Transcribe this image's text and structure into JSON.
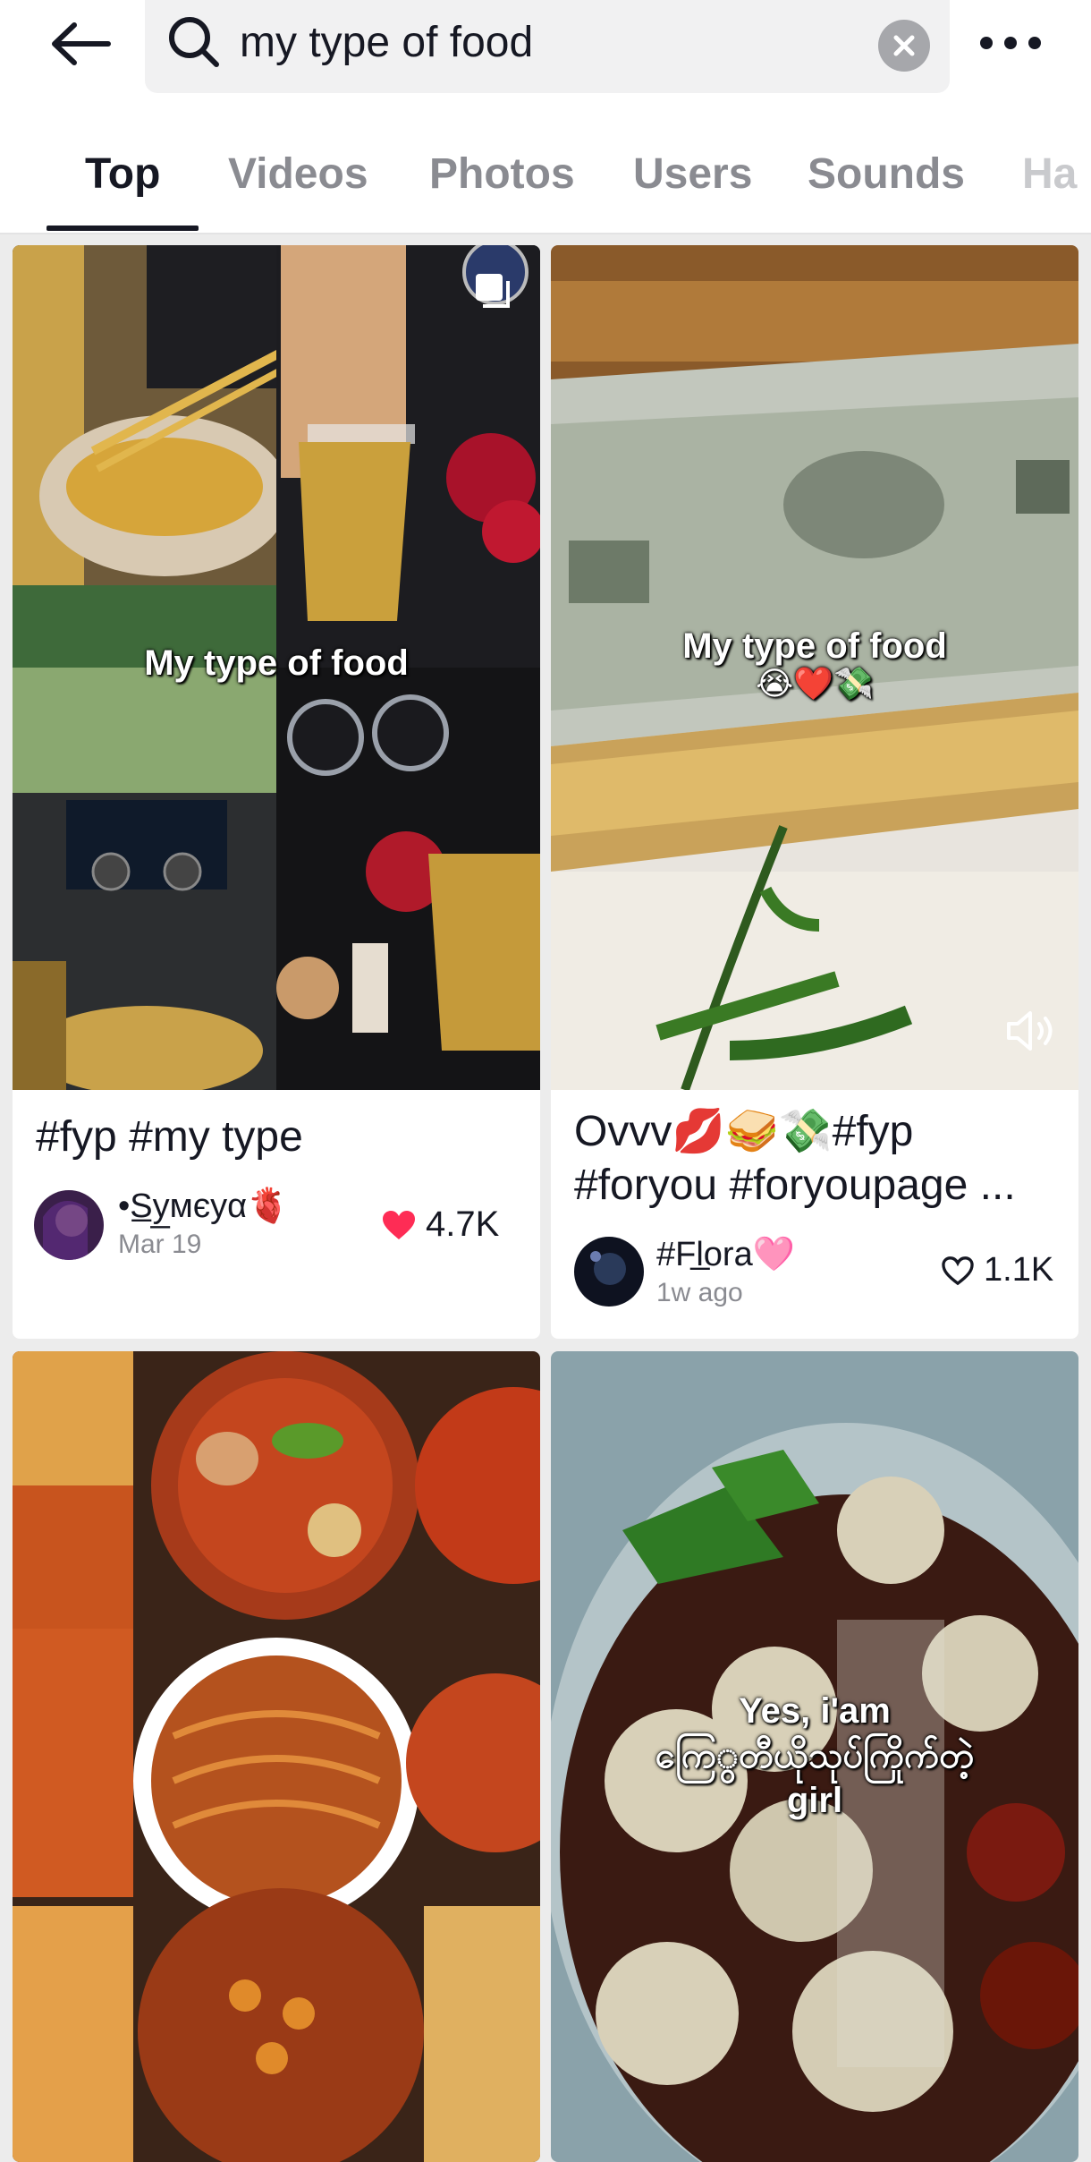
{
  "search": {
    "query": "my type of food"
  },
  "tabs": [
    {
      "label": "Top"
    },
    {
      "label": "Videos"
    },
    {
      "label": "Photos"
    },
    {
      "label": "Users"
    },
    {
      "label": "Sounds"
    },
    {
      "label": "Ha"
    }
  ],
  "results": [
    {
      "overlay_text": "My type of food",
      "title": "#fyp #my type",
      "username": "•S̲y̲мєуα🫀",
      "date": "Mar 19",
      "likes": "4.7K",
      "liked": true
    },
    {
      "overlay_text": "My type of food",
      "overlay_emoji": "😭❤️💸",
      "title_line1": "Ovvv💋🥪💸#fyp",
      "title_line2": "#foryou #foryoupage ...",
      "username": "#Fl̲ora🩷",
      "date": "1w ago",
      "likes": "1.1K",
      "liked": false
    },
    {
      "overlay_text": ""
    },
    {
      "overlay_line1": "Yes, i'am",
      "overlay_line2": "ကြေွတီယိုသုပ်ကြိုက်တဲ့",
      "overlay_line3": "girl"
    }
  ],
  "colors": {
    "like_red": "#fe2c55",
    "text_primary": "#161823",
    "text_secondary": "#8a8b91"
  }
}
